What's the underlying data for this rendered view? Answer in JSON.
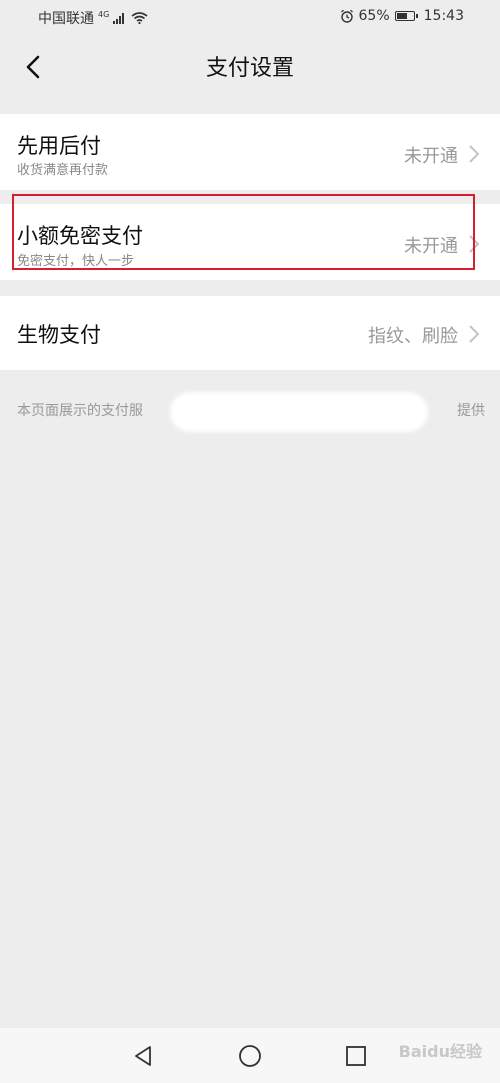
{
  "status_bar": {
    "carrier": "中国联通",
    "network": "4G",
    "battery": "65%",
    "time": "15:43"
  },
  "header": {
    "title": "支付设置"
  },
  "rows": [
    {
      "name": "先用后付",
      "sub": "收货满意再付款",
      "status": "未开通"
    },
    {
      "name": "小额免密支付",
      "sub": "免密支付，快人一步",
      "status": "未开通"
    },
    {
      "name": "生物支付",
      "status": "指纹、刷脸"
    }
  ],
  "footer_note": {
    "part1": "本页面展示的支付服",
    "part2": "提供"
  },
  "watermark": "Baidu经验",
  "colors": {
    "background": "#ededed",
    "card": "#ffffff",
    "highlight": "#d61f2b",
    "muted_text": "#999999"
  }
}
